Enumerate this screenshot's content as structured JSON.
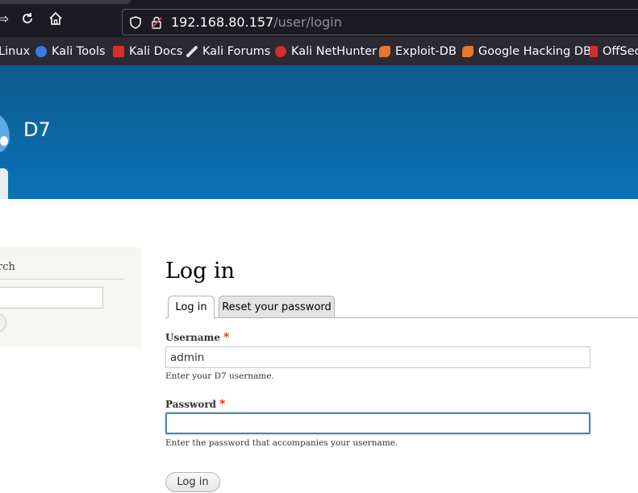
{
  "browser": {
    "url_host": "192.168.80.157",
    "url_path": "/user/login",
    "bookmarks": [
      {
        "label": "Linux",
        "icon": "kali-linux-icon",
        "color": "#1c1b22"
      },
      {
        "label": "Kali Tools",
        "icon": "kali-tools-icon",
        "color": "#3c7be0"
      },
      {
        "label": "Kali Docs",
        "icon": "kali-docs-icon",
        "color": "#d72d2d"
      },
      {
        "label": "Kali Forums",
        "icon": "kali-forums-icon",
        "color": "#dddddd"
      },
      {
        "label": "Kali NetHunter",
        "icon": "kali-nethunter-icon",
        "color": "#d32f2f"
      },
      {
        "label": "Exploit-DB",
        "icon": "exploit-db-icon",
        "color": "#e8762d"
      },
      {
        "label": "Google Hacking DB",
        "icon": "ghdb-icon",
        "color": "#e8762d"
      },
      {
        "label": "OffSec",
        "icon": "offsec-icon",
        "color": "#d32f2f"
      }
    ]
  },
  "header": {
    "site_name": "D7"
  },
  "sidebar": {
    "title": "rch"
  },
  "main": {
    "title": "Log in",
    "tabs": [
      {
        "label": "Log in",
        "active": true
      },
      {
        "label": "Reset your password",
        "active": false
      }
    ],
    "username": {
      "label": "Username",
      "required_mark": "*",
      "value": "admin",
      "description": "Enter your D7 username."
    },
    "password": {
      "label": "Password",
      "required_mark": "*",
      "value": "",
      "description": "Enter the password that accompanies your username."
    },
    "submit_label": "Log in"
  },
  "colors": {
    "header_top": "#0f5a8e",
    "header_bottom": "#0a73b7",
    "required": "#e62600",
    "focus": "#4d82b8"
  }
}
